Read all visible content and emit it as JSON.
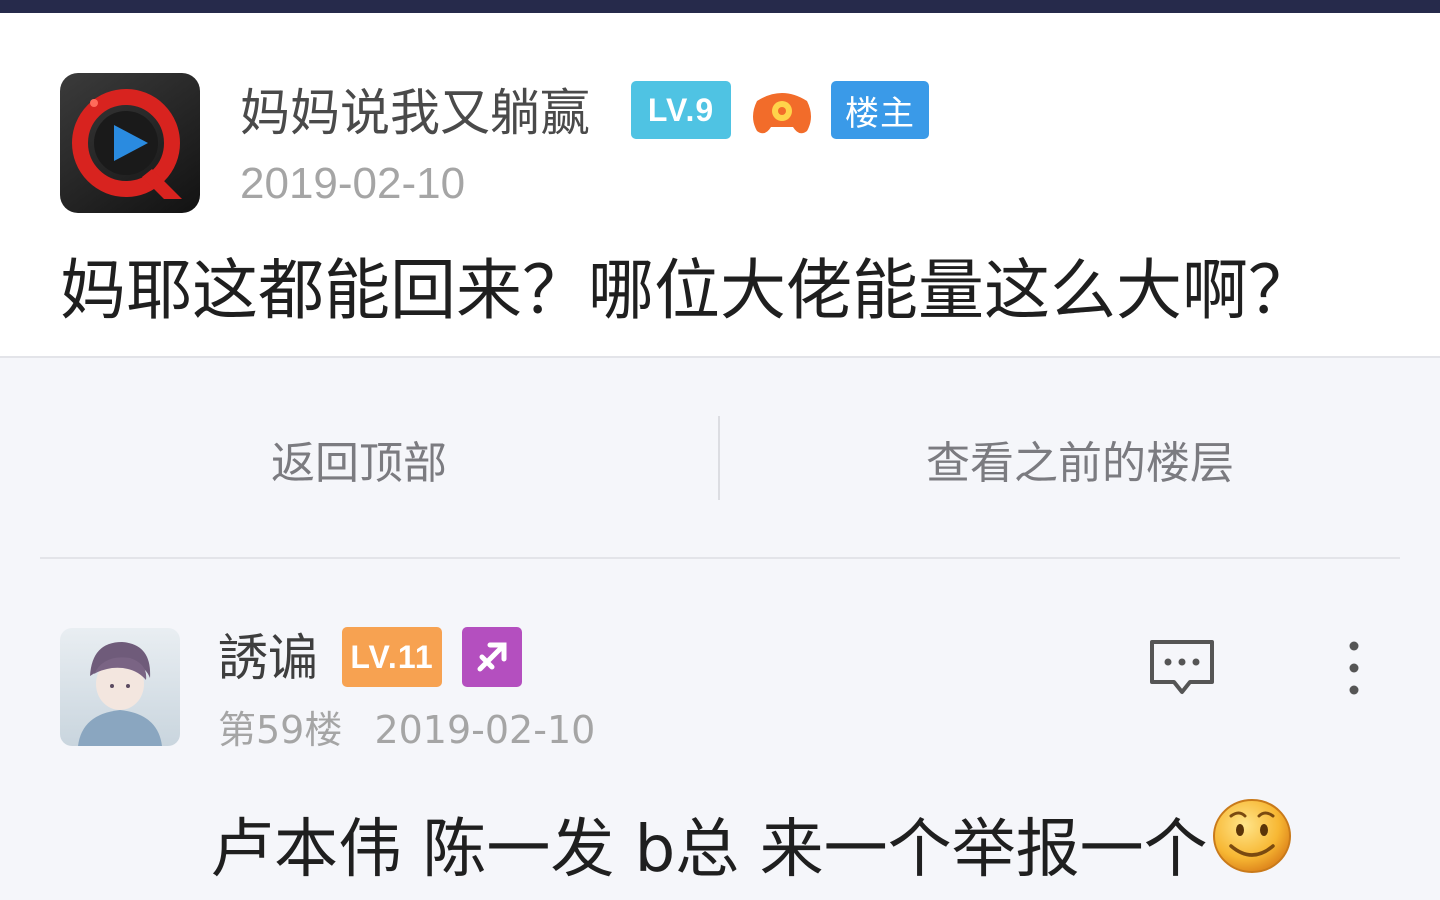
{
  "main_post": {
    "author": "妈妈说我又躺赢",
    "level_badge": "LV.9",
    "owner_badge": "楼主",
    "date": "2019-02-10",
    "content": "妈耶这都能回来？哪位大佬能量这么大啊？",
    "avatar_icon": "video-app-icon",
    "game_badge_icon": "gamepad-icon"
  },
  "actions": {
    "back_to_top": "返回顶部",
    "view_previous": "查看之前的楼层"
  },
  "reply": {
    "author": "誘谝",
    "level_badge": "LV.11",
    "zodiac_icon": "sagittarius-icon",
    "floor": "第59楼",
    "date": "2019-02-10",
    "content": "卢本伟 陈一发 b总 来一个举报一个",
    "emoji_icon": "smile-emoji-icon",
    "reply_icon": "comment-icon",
    "more_icon": "more-vertical-icon"
  },
  "colors": {
    "top_bar": "#262a4b",
    "level_blue": "#4fc3e3",
    "owner_blue": "#3a9ae8",
    "level_orange": "#f7a251",
    "zodiac_purple": "#b44fbf"
  }
}
